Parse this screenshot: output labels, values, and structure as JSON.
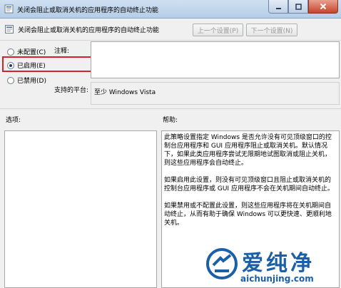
{
  "window": {
    "title": "关闭会阻止或取消关机的应用程序的自动终止功能"
  },
  "header": {
    "policy_title": "关闭会阻止或取消关机的应用程序的自动终止功能",
    "prev_button": "上一个设置(P)",
    "next_button": "下一个设置(N)"
  },
  "state_options": [
    {
      "label": "未配置(C)",
      "checked": false
    },
    {
      "label": "已启用(E)",
      "checked": true
    },
    {
      "label": "已禁用(D)",
      "checked": false
    }
  ],
  "comment": {
    "label": "注释:",
    "value": ""
  },
  "supported_on": {
    "label": "支持的平台:",
    "value": "至少 Windows Vista"
  },
  "options_panel": {
    "label": "选项:"
  },
  "help_panel": {
    "label": "帮助:",
    "paragraphs": [
      "此策略设置指定 Windows 是否允许没有可见顶级窗口的控制台应用程序和 GUI 应用程序阻止或取消关机。默认情况下，如果此类应用程序尝试无限期地试图取消或阻止关机，则这些应用程序会自动终止。",
      "如果启用此设置，则没有可见顶级窗口且阻止或取消关机的控制台应用程序或 GUI 应用程序不会在关机期间自动终止。",
      "如果禁用或不配置此设置，则这些应用程序将在关机期间自动终止，从而有助于确保 Windows 可以更快速、更顺利地关机。"
    ]
  },
  "watermark": {
    "name": "爱纯净",
    "url": "aichunjing.com"
  },
  "colors": {
    "highlight": "#d6202a",
    "brand": "#1b5fa8"
  }
}
